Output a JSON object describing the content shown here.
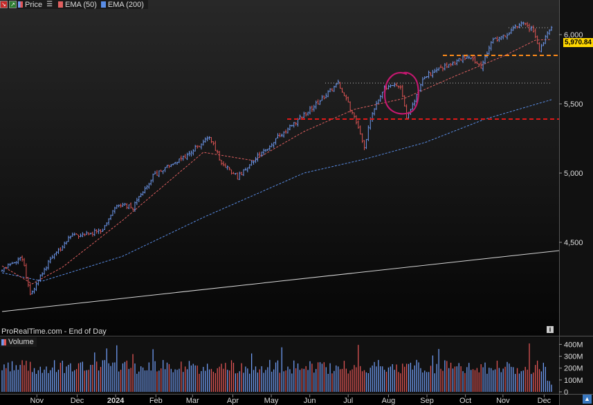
{
  "legend": {
    "price": "Price",
    "ema50": "EMA (50)",
    "ema200": "EMA (200)",
    "ema50_color": "#e06060",
    "ema200_color": "#5a8ee8"
  },
  "volume_label": "Volume",
  "footer": "ProRealTime.com - End of Day",
  "last_price_label": "5,970.84",
  "colors": {
    "up": "#6f9bf2",
    "down": "#e05555",
    "ema50": "#e06060",
    "ema200": "#5a8ee8",
    "support": "#e01818",
    "resistance": "#ff8c1a",
    "circle": "#c2186e",
    "trend": "#d8d8d8",
    "price_box": "#ffd700"
  },
  "chart_data": {
    "type": "candlestick",
    "x_labels": [
      "Nov",
      "Dec",
      "2024",
      "Feb",
      "Mar",
      "Apr",
      "May",
      "Jun",
      "Jul",
      "Aug",
      "Sep",
      "Oct",
      "Nov",
      "Dec"
    ],
    "price_ticks": [
      "6,000",
      "5,500",
      "5,000",
      "4,500"
    ],
    "price_tick_values": [
      6000,
      5500,
      5000,
      4500
    ],
    "volume_ticks": [
      "400M",
      "300M",
      "200M",
      "100M",
      "0"
    ],
    "volume_tick_values": [
      400,
      300,
      200,
      100,
      0
    ],
    "price_anchors": [
      [
        0,
        4300
      ],
      [
        10,
        4390
      ],
      [
        14,
        4120
      ],
      [
        20,
        4280
      ],
      [
        25,
        4400
      ],
      [
        35,
        4550
      ],
      [
        50,
        4580
      ],
      [
        57,
        4780
      ],
      [
        65,
        4750
      ],
      [
        75,
        4980
      ],
      [
        90,
        5110
      ],
      [
        103,
        5260
      ],
      [
        109,
        5080
      ],
      [
        117,
        4970
      ],
      [
        125,
        5090
      ],
      [
        140,
        5300
      ],
      [
        155,
        5480
      ],
      [
        167,
        5650
      ],
      [
        175,
        5410
      ],
      [
        180,
        5180
      ],
      [
        183,
        5400
      ],
      [
        190,
        5620
      ],
      [
        198,
        5630
      ],
      [
        201,
        5400
      ],
      [
        210,
        5700
      ],
      [
        225,
        5800
      ],
      [
        232,
        5850
      ],
      [
        238,
        5770
      ],
      [
        243,
        5950
      ],
      [
        251,
        6000
      ],
      [
        258,
        6090
      ],
      [
        264,
        6030
      ],
      [
        267,
        5880
      ],
      [
        271,
        6010
      ],
      [
        273,
        6060
      ]
    ],
    "ema50_anchors": [
      [
        0,
        4330
      ],
      [
        15,
        4200
      ],
      [
        30,
        4320
      ],
      [
        60,
        4660
      ],
      [
        100,
        5150
      ],
      [
        125,
        5090
      ],
      [
        150,
        5300
      ],
      [
        175,
        5460
      ],
      [
        200,
        5540
      ],
      [
        225,
        5700
      ],
      [
        250,
        5850
      ],
      [
        265,
        5960
      ],
      [
        273,
        5965
      ]
    ],
    "ema200_anchors": [
      [
        0,
        4280
      ],
      [
        20,
        4220
      ],
      [
        60,
        4400
      ],
      [
        100,
        4680
      ],
      [
        150,
        5000
      ],
      [
        180,
        5100
      ],
      [
        210,
        5220
      ],
      [
        240,
        5390
      ],
      [
        273,
        5530
      ]
    ],
    "support_level": 5390,
    "resistance_level": 5850,
    "dotted_high_1": 5650,
    "dotted_high_2": 6050,
    "trendline": [
      [
        0,
        4000
      ],
      [
        273,
        4440
      ]
    ],
    "volume_range": [
      0,
      420
    ]
  }
}
